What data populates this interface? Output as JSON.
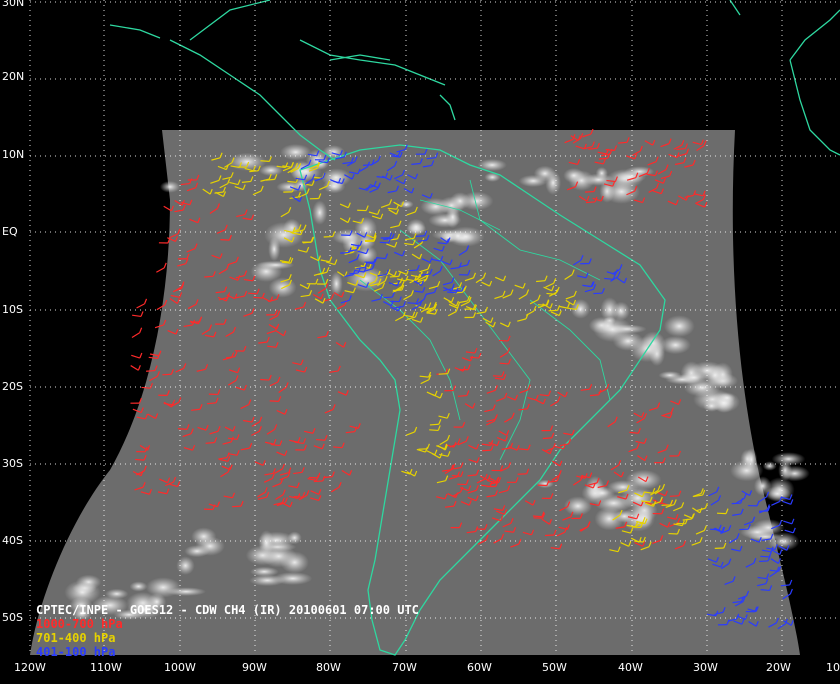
{
  "map": {
    "caption": "CPTEC/INPE - GOES12 - CDW CH4 (IR) 20100601 07:00 UTC",
    "legend": [
      {
        "label": "1000-700 hPa",
        "color": "#ff2a2a"
      },
      {
        "label": "701-400 hPa",
        "color": "#e6d200"
      },
      {
        "label": "401-100 hPa",
        "color": "#2a3cff"
      }
    ],
    "lat_labels": [
      "30N",
      "20N",
      "10N",
      "EQ",
      "10S",
      "20S",
      "30S",
      "40S",
      "50S"
    ],
    "lon_labels": [
      "120W",
      "110W",
      "100W",
      "90W",
      "80W",
      "70W",
      "60W",
      "50W",
      "40W",
      "30W",
      "20W",
      "10"
    ],
    "colors": {
      "background": "#000000",
      "coastline": "#2ed8a0",
      "grid": "#ffffff",
      "satellite_disk": "#6e6e6e"
    }
  }
}
